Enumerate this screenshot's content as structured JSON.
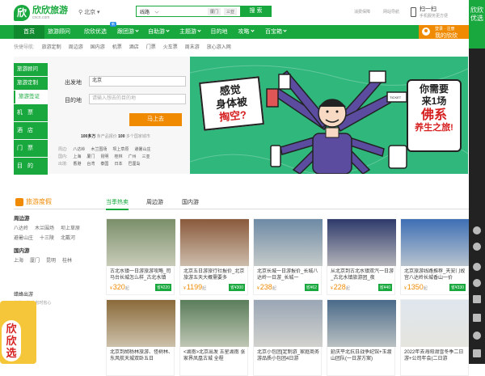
{
  "brand": {
    "name": "欣欣旅游",
    "url": "cncn.com",
    "mark": "欣"
  },
  "city": "北京",
  "search": {
    "type": "线路",
    "hot": [
      "厦门",
      "三亚"
    ],
    "button": "搜 索"
  },
  "toplinks": [
    "消费保障",
    "网站导航"
  ],
  "scan": {
    "title": "扫一扫",
    "sub": "手机服务更方便"
  },
  "nav": {
    "items": [
      "首页",
      "旅游顾问",
      "欣欣优选",
      "跟团游",
      "自助游",
      "主题游",
      "目的地",
      "攻略",
      "百宝箱"
    ],
    "badge": "新"
  },
  "login": {
    "line1": "登录 · 注册",
    "line2": "我的欣欣"
  },
  "quick": {
    "label": "快捷导航:",
    "items": [
      "旅游定制",
      "周边游",
      "国内游",
      "机票",
      "酒店",
      "门票",
      "火车票",
      "周末游",
      "放心游入网"
    ]
  },
  "tabs": [
    "旅游顾问",
    "旅游定制",
    "旅游签证",
    "机票",
    "酒店",
    "门票",
    "目的地"
  ],
  "form": {
    "from_label": "出发地",
    "from_value": "北京",
    "to_label": "目的地",
    "to_placeholder": "请输入想去的目的地",
    "go": "马上去"
  },
  "stats": {
    "n1": "100多万",
    "t1": "条产品报价",
    "n2": "100",
    "t2": "多个国家城市"
  },
  "city_list": [
    {
      "label": "周边:",
      "items": [
        "八达岭",
        "木兰围场",
        "坝上草原",
        "避暑山庄"
      ]
    },
    {
      "label": "国内:",
      "items": [
        "上海",
        "厦门",
        "昆明",
        "桂林",
        "广州",
        "三亚"
      ]
    },
    {
      "label": "出境:",
      "items": [
        "香港",
        "台湾",
        "泰国",
        "日本",
        "巴厘岛"
      ]
    }
  ],
  "banner": {
    "left_l1": "感觉",
    "left_l2": "身体被",
    "left_l3": "掏空?",
    "right_l1": "你需要",
    "right_l2": "来1场",
    "right_l3": "佛系",
    "right_l4": "养生之旅!",
    "ticket": "TICKET"
  },
  "visa": {
    "title": "旅游度假",
    "tabs": [
      "当季热卖",
      "周边游",
      "国内游"
    ]
  },
  "sidecats": [
    {
      "title": "周边游",
      "rows": [
        [
          "八达岭",
          "木兰围场",
          "坝上草原"
        ],
        [
          "避暑山庄",
          "十三陵",
          "北戴河"
        ]
      ]
    },
    {
      "title": "国内游",
      "rows": [
        [
          "上海",
          "厦门",
          "昆明",
          "桂林"
        ]
      ]
    }
  ],
  "promo": {
    "title": "蜡蜂出游",
    "sub": "旅游正当时 省时省心"
  },
  "float_ad": {
    "text": "欣欣选"
  },
  "cards": [
    {
      "title": "古北水镇一日游旅游攻略_司马台长城怎么样_古北水镇",
      "price": "320",
      "save": "省¥220",
      "color": "#7a8f6a"
    },
    {
      "title": "北京五日游旅行社报价_北京旅游五天大概需要多",
      "price": "1199",
      "save": "省¥300",
      "color": "#8a5a3c"
    },
    {
      "title": "北京长城一日游报价_长城八达岭一日游_长城一",
      "price": "238",
      "save": "省¥62",
      "color": "#6d8aa5"
    },
    {
      "title": "从北京到古北水镇双汽一日游_古北水镇旅游团_夜",
      "price": "228",
      "save": "省¥40",
      "color": "#2e3a6b"
    },
    {
      "title": "北京旅游线路推荐_天安门故宫八达岭长城香山一价",
      "price": "1350",
      "save": "省¥330",
      "color": "#3e6fb5"
    },
    {
      "title": "北京到胡杨林旅游、怪树林、东风航天城双卧五日",
      "price": "",
      "save": "",
      "color": "#8a6a3a"
    },
    {
      "title": "<湖南>北京出发 五星湖南 张家界凤凰古城 全程",
      "price": "",
      "save": "",
      "color": "#5a7d5a"
    },
    {
      "title": "北京小包团[定制游_家庭商务游品质小包团4日游",
      "price": "",
      "save": "",
      "color": "#9aa6b5"
    },
    {
      "title": "延庆平北抗日战争纪馆+玉渡山团队(一日游方案)",
      "price": "",
      "save": "",
      "color": "#4a6a8a"
    },
    {
      "title": "2022年去海阳滑雪冬季二日游+公司年会(二日游",
      "price": "",
      "save": "",
      "color": "#dfe6ee"
    }
  ],
  "rail": {
    "top": "欣欣优选"
  }
}
